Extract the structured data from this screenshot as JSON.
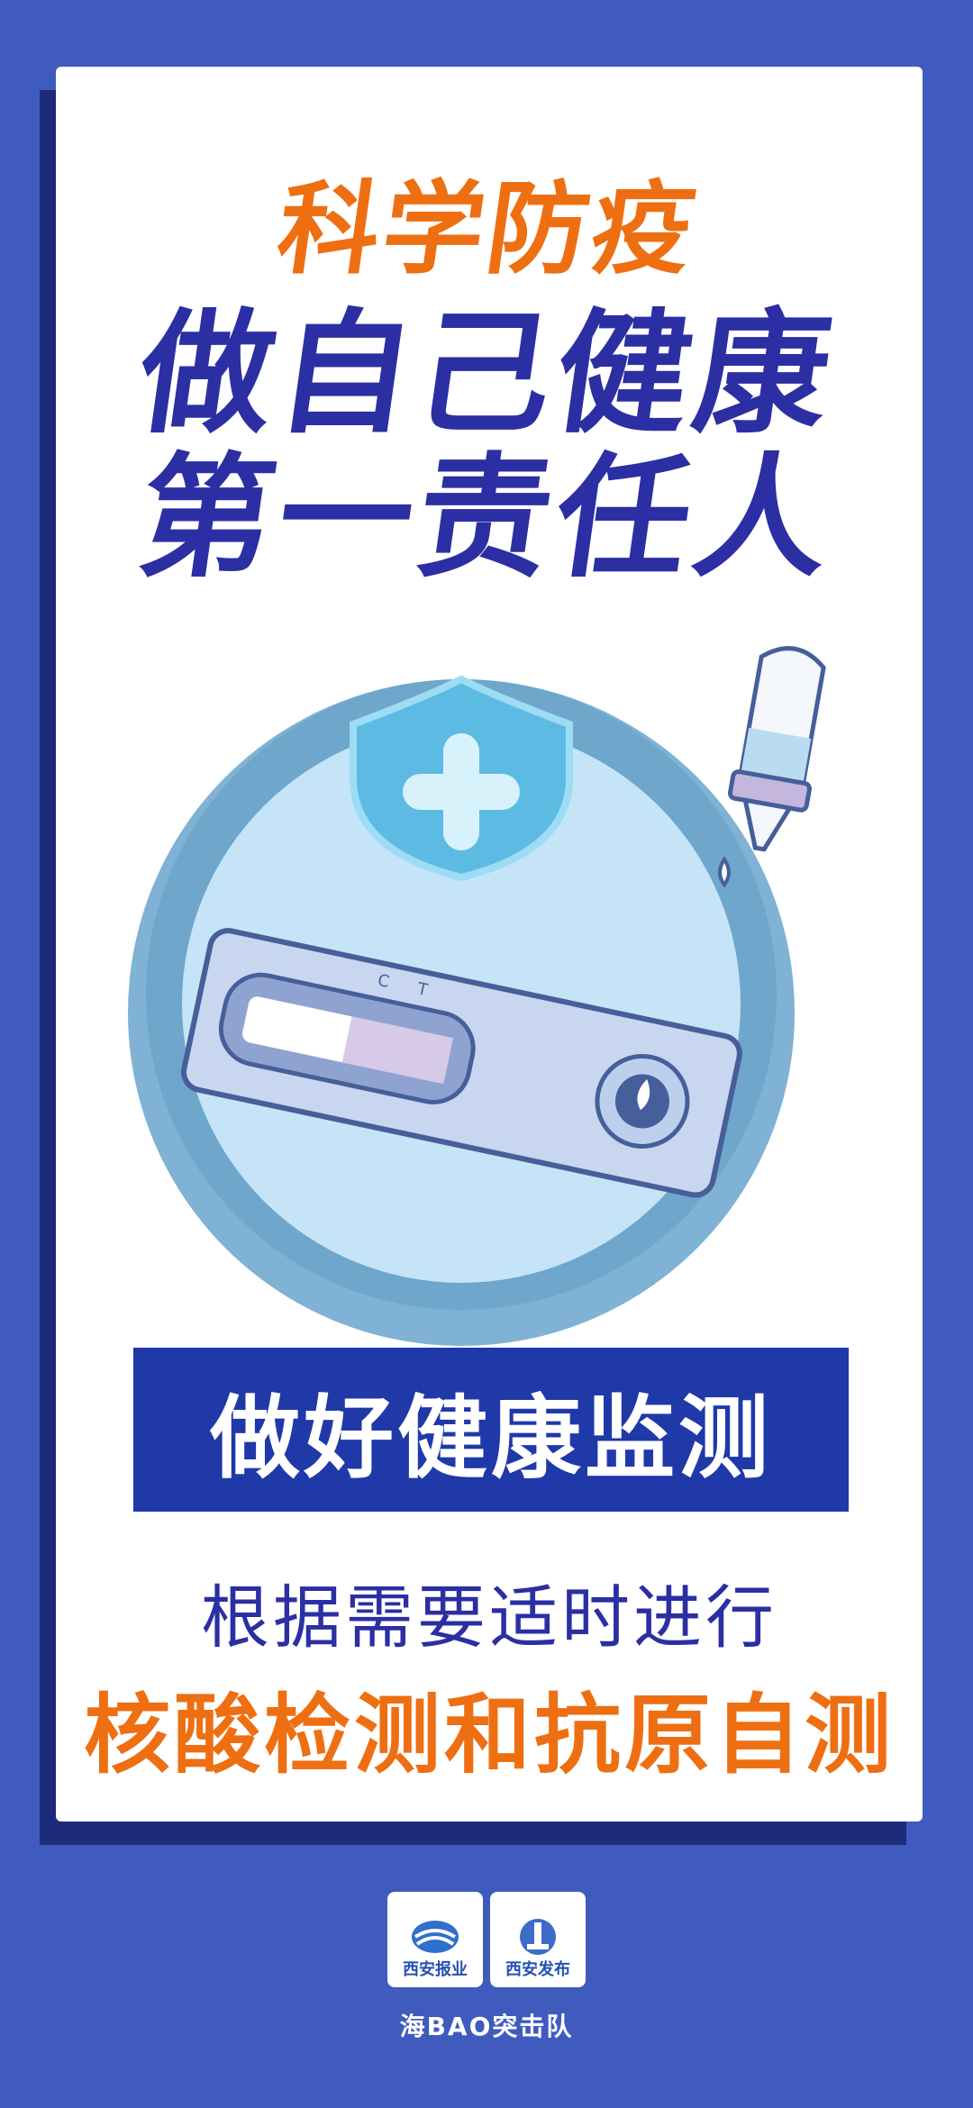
{
  "headline": {
    "line1": "科学防疫",
    "line2": "做自己健康",
    "line3": "第一责任人"
  },
  "illustration": {
    "strip_label_c": "C",
    "strip_label_t": "T"
  },
  "banner": {
    "text": "做好健康监测"
  },
  "body": {
    "line1": "根据需要适时进行",
    "line2": "核酸检测和抗原自测"
  },
  "logos": [
    {
      "text": "西安报业",
      "icon": "xian-newspaper-logo-icon"
    },
    {
      "text": "西安发布",
      "icon": "xian-release-logo-icon"
    }
  ],
  "footer": {
    "text": "海BAO突击队"
  },
  "colors": {
    "background": "#3f5bbd",
    "orange": "#ee6f12",
    "navy": "#2b2fa3",
    "banner": "#1f39a8"
  }
}
